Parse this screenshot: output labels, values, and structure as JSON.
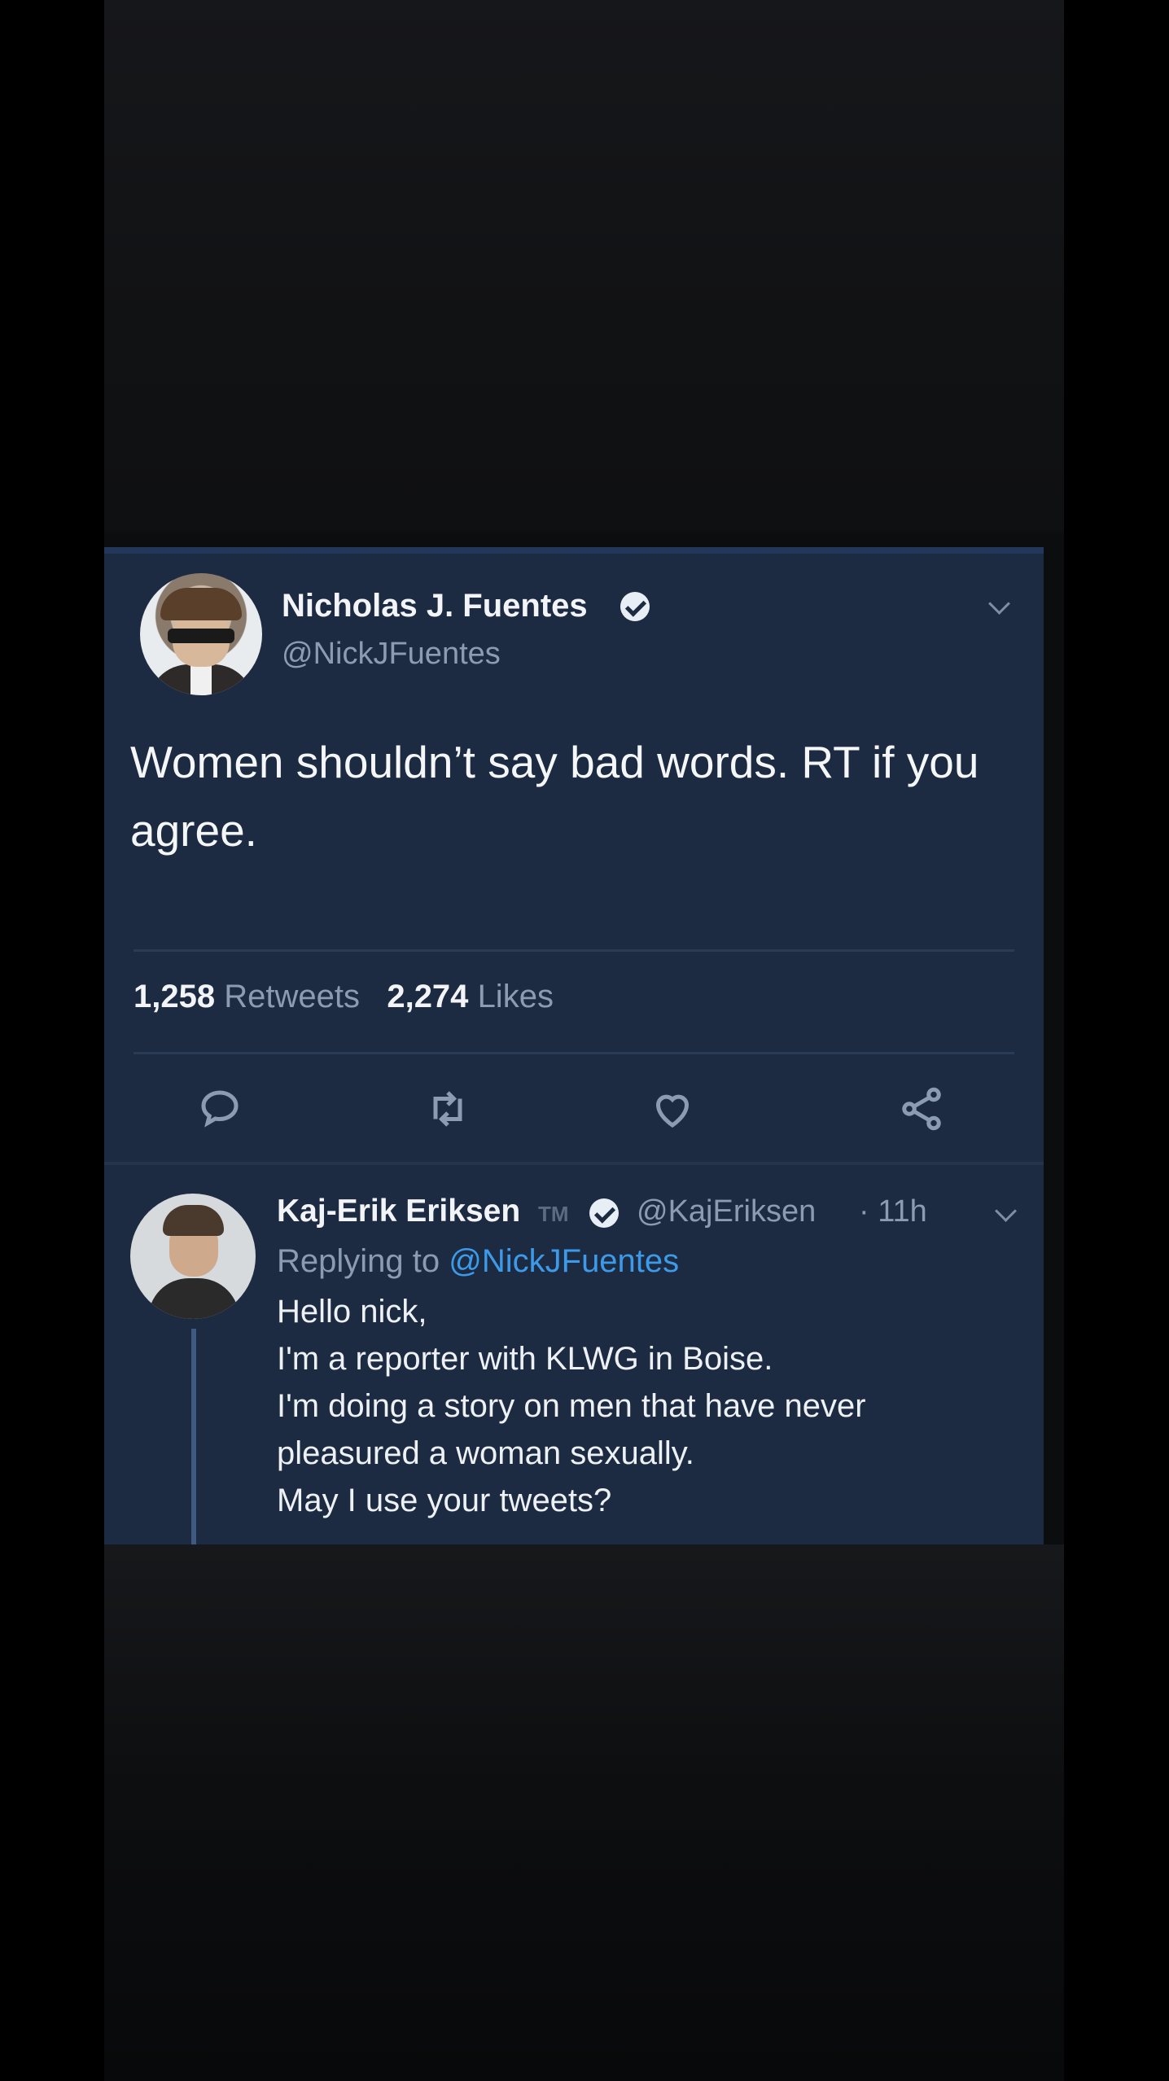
{
  "colors": {
    "card_background": "#1c2b42",
    "link": "#3d9ae8",
    "secondary_text": "#8a9bb2",
    "primary_text": "#f2f4f7"
  },
  "tweet": {
    "author_name": "Nicholas J. Fuentes",
    "author_handle": "@NickJFuentes",
    "text": "Women shouldn’t say bad words. RT if you agree.",
    "retweets_count": "1,258",
    "retweets_label": "Retweets",
    "likes_count": "2,274",
    "likes_label": "Likes",
    "actions": [
      "reply-icon",
      "retweet-icon",
      "heart-icon",
      "share-icon"
    ]
  },
  "reply": {
    "author_name": "Kaj-Erik Eriksen",
    "tm_mark": "TM",
    "author_handle": "@KajEriksen",
    "time": "· 11h",
    "replying_prefix": "Replying to",
    "replying_to": "@NickJFuentes",
    "lines": [
      "Hello nick,",
      "I'm a reporter with KLWG in Boise.",
      "I'm doing a story on men that have never",
      "pleasured a woman sexually.",
      "May I use your tweets?"
    ]
  }
}
